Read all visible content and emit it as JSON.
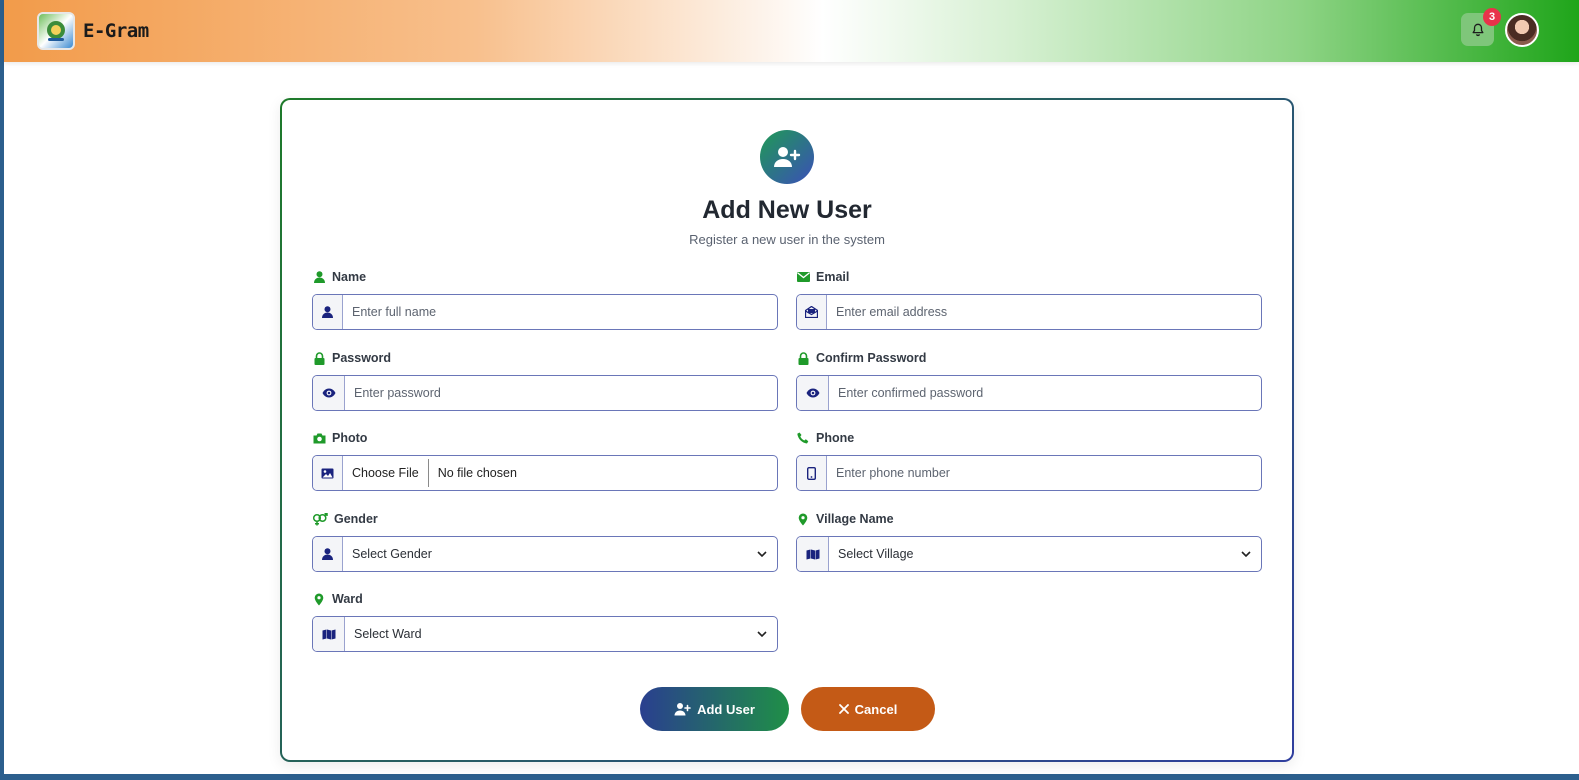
{
  "navbar": {
    "brand_name": "E-Gram",
    "notification_count": "3",
    "colors": {
      "saffron": "#f29b4a",
      "green": "#1fa51a"
    }
  },
  "form": {
    "title": "Add New User",
    "subtitle": "Register a new user in the system",
    "fields": {
      "name": {
        "label": "Name",
        "placeholder": "Enter full name"
      },
      "email": {
        "label": "Email",
        "placeholder": "Enter email address"
      },
      "password": {
        "label": "Password",
        "placeholder": "Enter password"
      },
      "confirm_password": {
        "label": "Confirm Password",
        "placeholder": "Enter confirmed password"
      },
      "photo": {
        "label": "Photo",
        "button_label": "Choose File",
        "status": "No file chosen"
      },
      "phone": {
        "label": "Phone",
        "placeholder": "Enter phone number"
      },
      "gender": {
        "label": "Gender",
        "selected": "Select Gender"
      },
      "village": {
        "label": "Village Name",
        "selected": "Select Village"
      },
      "ward": {
        "label": "Ward",
        "selected": "Select Ward"
      }
    },
    "buttons": {
      "add_label": "Add User",
      "cancel_label": "Cancel"
    }
  },
  "icons": {
    "label_color": "#1f9a2a",
    "addon_color": "#1a237e"
  }
}
